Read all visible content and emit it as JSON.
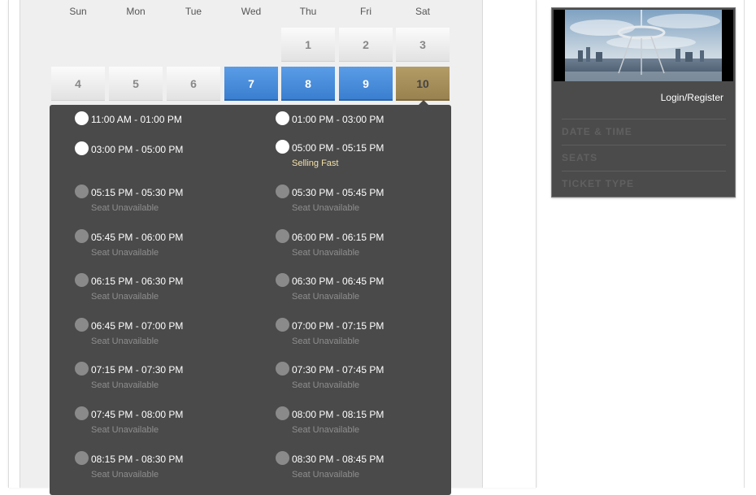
{
  "calendar": {
    "weekdays": [
      "Sun",
      "Mon",
      "Tue",
      "Wed",
      "Thu",
      "Fri",
      "Sat"
    ],
    "days": [
      {
        "label": "1",
        "state": "unavailable"
      },
      {
        "label": "2",
        "state": "unavailable"
      },
      {
        "label": "3",
        "state": "unavailable"
      },
      {
        "label": "4",
        "state": "unavailable"
      },
      {
        "label": "5",
        "state": "unavailable"
      },
      {
        "label": "6",
        "state": "unavailable"
      },
      {
        "label": "7",
        "state": "available"
      },
      {
        "label": "8",
        "state": "available"
      },
      {
        "label": "9",
        "state": "available"
      },
      {
        "label": "10",
        "state": "selected"
      }
    ]
  },
  "slots": [
    {
      "time": "11:00 AM - 01:00 PM",
      "status": "",
      "available": true
    },
    {
      "time": "01:00 PM - 03:00 PM",
      "status": "",
      "available": true
    },
    {
      "time": "03:00 PM - 05:00 PM",
      "status": "",
      "available": true
    },
    {
      "time": "05:00 PM - 05:15 PM",
      "status": "Selling Fast",
      "available": true
    },
    {
      "time": "05:15 PM - 05:30 PM",
      "status": "Seat Unavailable",
      "available": false
    },
    {
      "time": "05:30 PM - 05:45 PM",
      "status": "Seat Unavailable",
      "available": false
    },
    {
      "time": "05:45 PM - 06:00 PM",
      "status": "Seat Unavailable",
      "available": false
    },
    {
      "time": "06:00 PM - 06:15 PM",
      "status": "Seat Unavailable",
      "available": false
    },
    {
      "time": "06:15 PM - 06:30 PM",
      "status": "Seat Unavailable",
      "available": false
    },
    {
      "time": "06:30 PM - 06:45 PM",
      "status": "Seat Unavailable",
      "available": false
    },
    {
      "time": "06:45 PM - 07:00 PM",
      "status": "Seat Unavailable",
      "available": false
    },
    {
      "time": "07:00 PM - 07:15 PM",
      "status": "Seat Unavailable",
      "available": false
    },
    {
      "time": "07:15 PM - 07:30 PM",
      "status": "Seat Unavailable",
      "available": false
    },
    {
      "time": "07:30 PM - 07:45 PM",
      "status": "Seat Unavailable",
      "available": false
    },
    {
      "time": "07:45 PM - 08:00 PM",
      "status": "Seat Unavailable",
      "available": false
    },
    {
      "time": "08:00 PM - 08:15 PM",
      "status": "Seat Unavailable",
      "available": false
    },
    {
      "time": "08:15 PM - 08:30 PM",
      "status": "Seat Unavailable",
      "available": false
    },
    {
      "time": "08:30 PM - 08:45 PM",
      "status": "Seat Unavailable",
      "available": false
    }
  ],
  "sidebar": {
    "login_label": "Login/Register",
    "steps": [
      "DATE & TIME",
      "SEATS",
      "TICKET TYPE"
    ]
  },
  "colors": {
    "available_day": "#4a8ddc",
    "selected_day": "#a88f5b",
    "panel_dark": "#4a4a4a",
    "selling_fast": "#f2e0a8"
  }
}
